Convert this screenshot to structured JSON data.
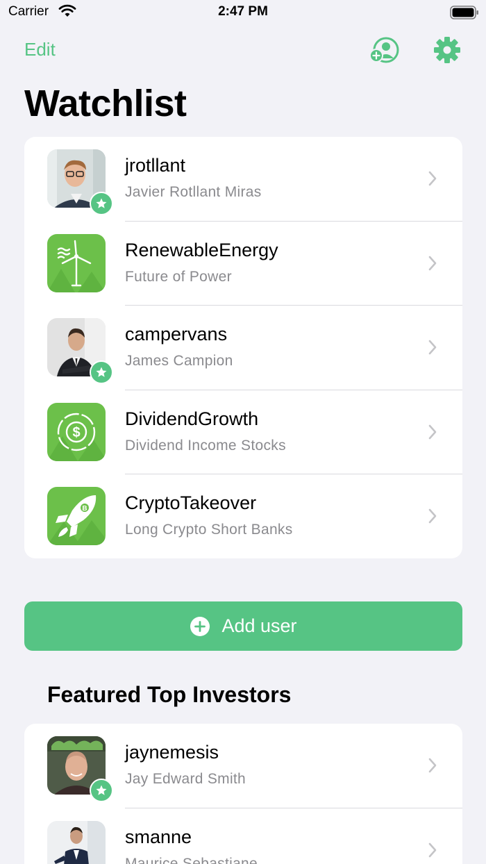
{
  "status_bar": {
    "carrier": "Carrier",
    "time": "2:47 PM"
  },
  "nav": {
    "edit_label": "Edit",
    "add_user_icon": "person-plus-icon",
    "settings_icon": "gear-icon"
  },
  "title": "Watchlist",
  "watchlist": [
    {
      "username": "jrotllant",
      "subtitle": "Javier Rotllant Miras",
      "avatar": "person-photo",
      "starred": true
    },
    {
      "username": "RenewableEnergy",
      "subtitle": "Future of Power",
      "avatar": "wind-turbine-icon",
      "starred": false
    },
    {
      "username": "campervans",
      "subtitle": "James Campion",
      "avatar": "person-photo",
      "starred": true
    },
    {
      "username": "DividendGrowth",
      "subtitle": "Dividend Income Stocks",
      "avatar": "dollar-coin-icon",
      "starred": false
    },
    {
      "username": "CryptoTakeover",
      "subtitle": "Long Crypto Short Banks",
      "avatar": "rocket-icon",
      "starred": false
    }
  ],
  "add_user_button": {
    "label": "Add user",
    "icon": "plus-circle-icon"
  },
  "featured": {
    "title": "Featured Top Investors",
    "items": [
      {
        "username": "jaynemesis",
        "subtitle": "Jay Edward Smith",
        "avatar": "person-photo",
        "starred": true
      },
      {
        "username": "smanne",
        "subtitle": "Maurice Sebastiane",
        "avatar": "person-photo",
        "starred": false
      }
    ]
  },
  "colors": {
    "accent": "#56c484",
    "background": "#f2f2f7",
    "secondary_text": "#8a8a8e"
  }
}
